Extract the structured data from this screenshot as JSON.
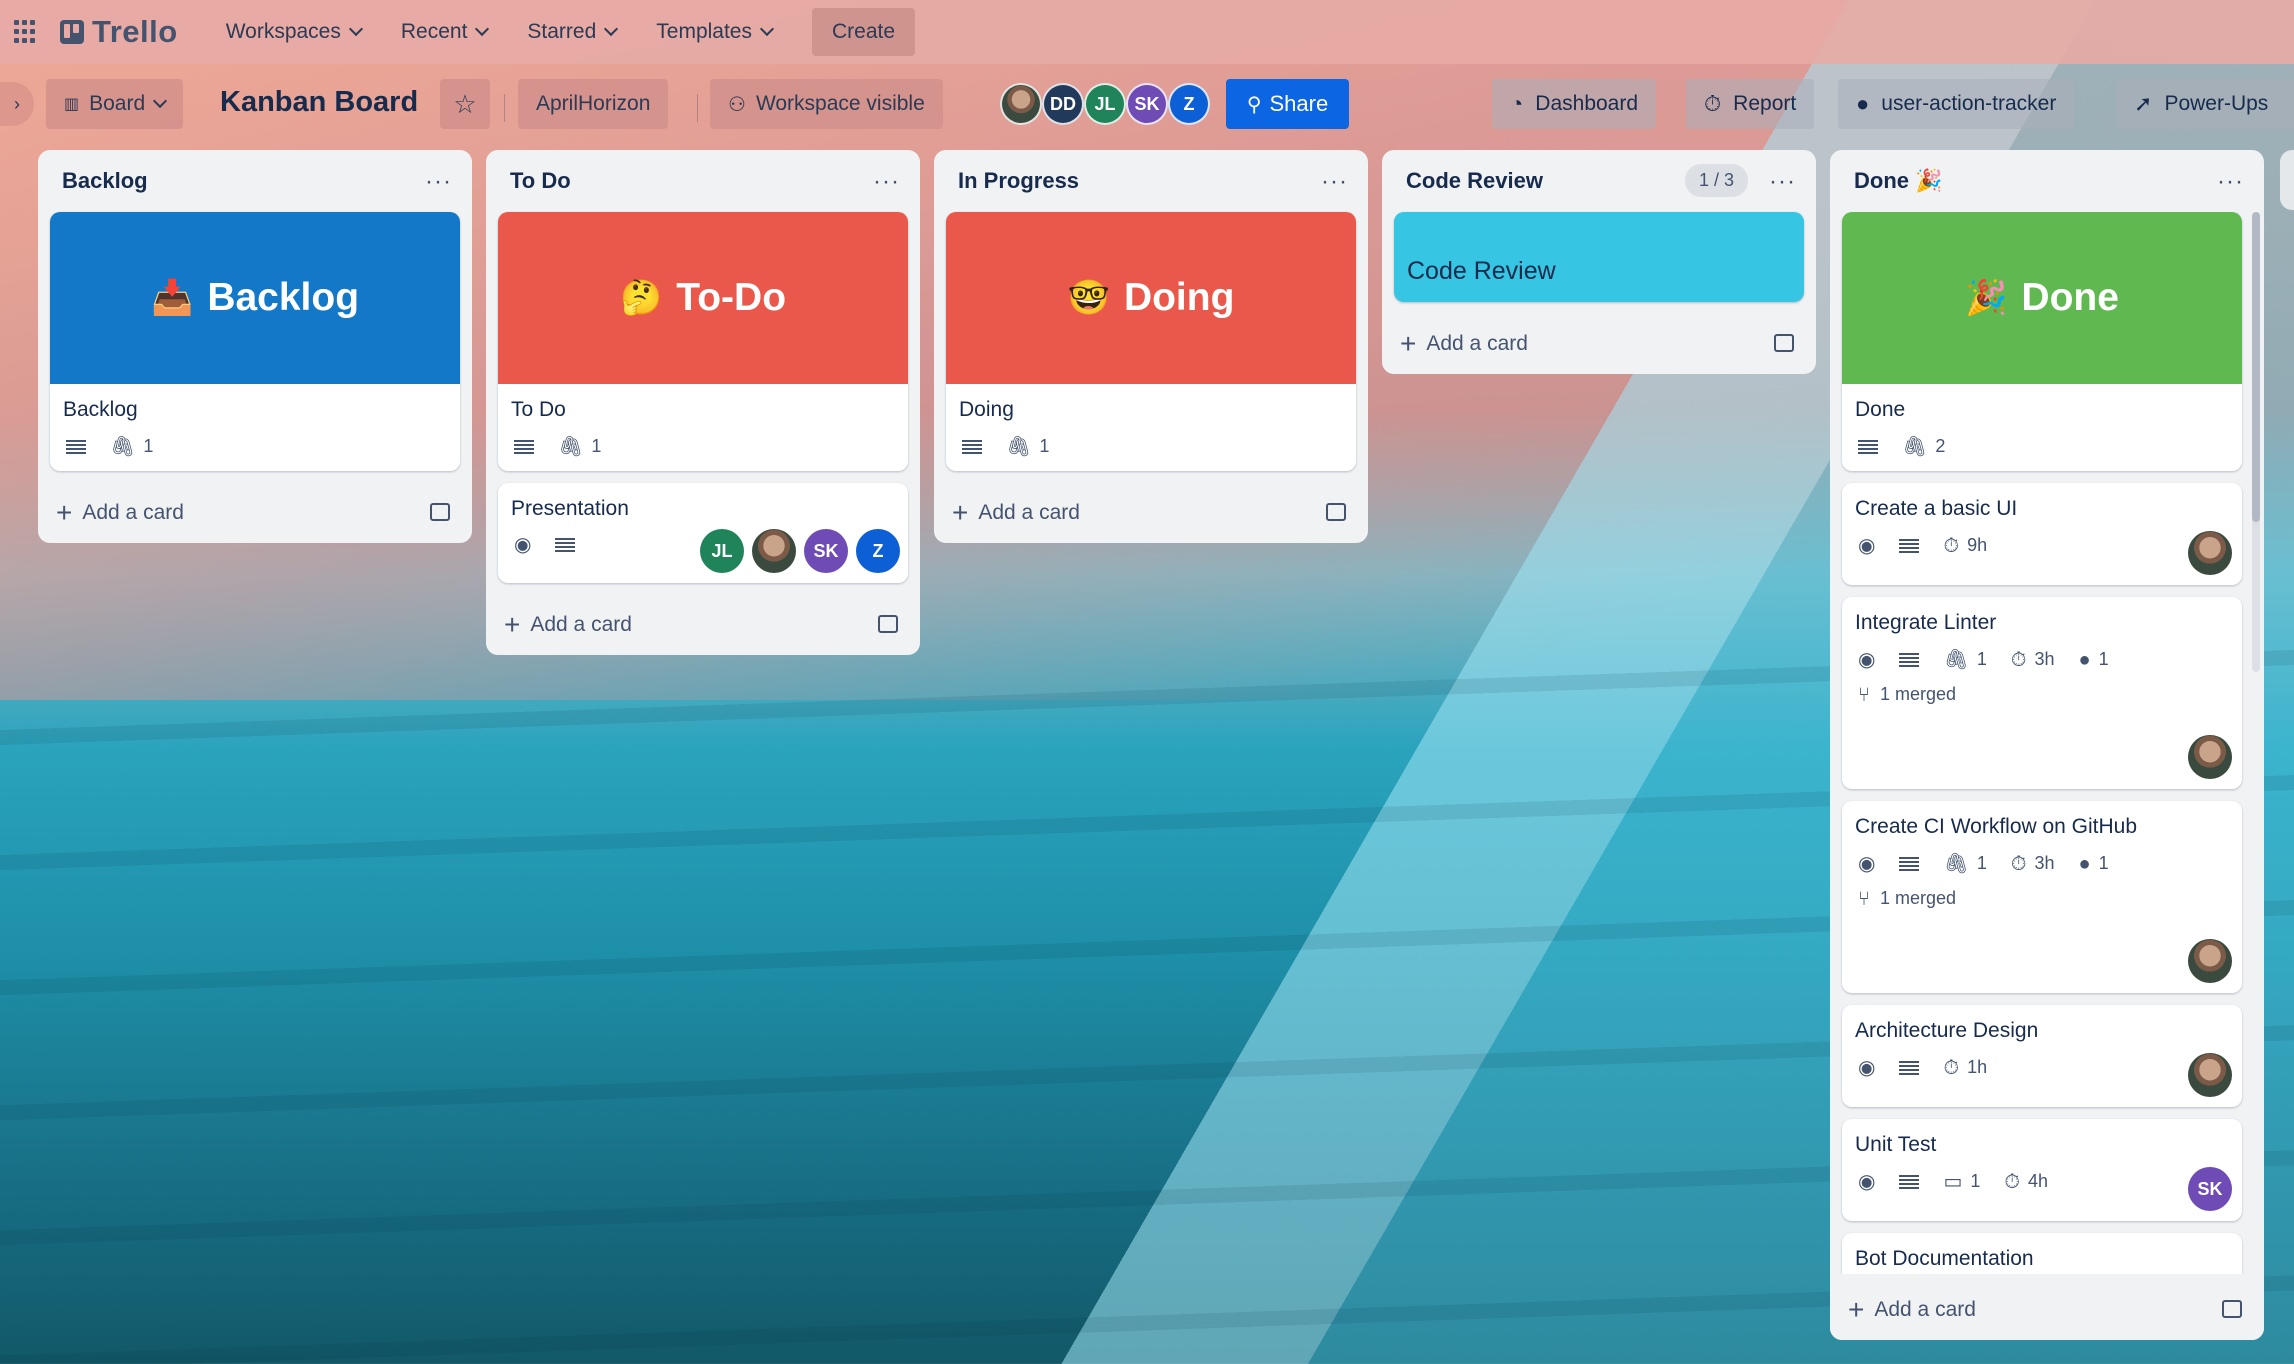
{
  "topnav": {
    "logo": "Trello",
    "items": [
      {
        "label": "Workspaces"
      },
      {
        "label": "Recent"
      },
      {
        "label": "Starred"
      },
      {
        "label": "Templates"
      }
    ],
    "create_label": "Create"
  },
  "board": {
    "view_label": "Board",
    "title": "Kanban Board",
    "workspace": "AprilHorizon",
    "visibility": "Workspace visible",
    "members": [
      "DD",
      "JL",
      "SK",
      "Z"
    ],
    "share_label": "Share",
    "right_buttons": [
      {
        "label": "Dashboard"
      },
      {
        "label": "Report"
      },
      {
        "label": "user-action-tracker"
      },
      {
        "label": "Power-Ups"
      }
    ]
  },
  "colors": {
    "share": "#0c66e4",
    "backlog_cover": "#1378c8",
    "todo_cover": "#e9584a",
    "doing_cover": "#e9584a",
    "code_review_cover": "#36c5e3",
    "done_cover": "#5fb950",
    "jl": "#1f845a",
    "sk": "#6e4bb5",
    "z": "#0c5fd4",
    "dd": "#213a5c"
  },
  "lists": {
    "backlog": {
      "title": "Backlog",
      "cover_text": "Backlog",
      "cover_emoji": "📥",
      "card_title": "Backlog",
      "attachments": "1",
      "add_card": "Add a card"
    },
    "todo": {
      "title": "To Do",
      "cover_text": "To-Do",
      "cover_emoji": "🤔",
      "card_title": "To Do",
      "attachments": "1",
      "card2_title": "Presentation",
      "card2_members": [
        "JL",
        "SK",
        "Z"
      ],
      "add_card": "Add a card"
    },
    "inprogress": {
      "title": "In Progress",
      "cover_text": "Doing",
      "cover_emoji": "🤓",
      "card_title": "Doing",
      "attachments": "1",
      "add_card": "Add a card"
    },
    "codereview": {
      "title": "Code Review",
      "count": "1 / 3",
      "card_title": "Code Review",
      "add_card": "Add a card"
    },
    "done": {
      "title": "Done",
      "title_emoji": "🎉",
      "cover_text": "Done",
      "cover_emoji": "🎉",
      "card_title": "Done",
      "attachments": "2",
      "cards": [
        {
          "title": "Create a basic UI",
          "time": "9h"
        },
        {
          "title": "Integrate Linter",
          "attachments": "1",
          "time": "3h",
          "github": "1",
          "merged": "1 merged"
        },
        {
          "title": "Create CI Workflow on GitHub",
          "attachments": "1",
          "time": "3h",
          "github": "1",
          "merged": "1 merged"
        },
        {
          "title": "Architecture Design",
          "time": "1h"
        },
        {
          "title": "Unit Test",
          "comments": "1",
          "time": "4h",
          "member": "SK"
        },
        {
          "title": "Bot Documentation"
        }
      ],
      "add_card": "Add a card"
    }
  }
}
